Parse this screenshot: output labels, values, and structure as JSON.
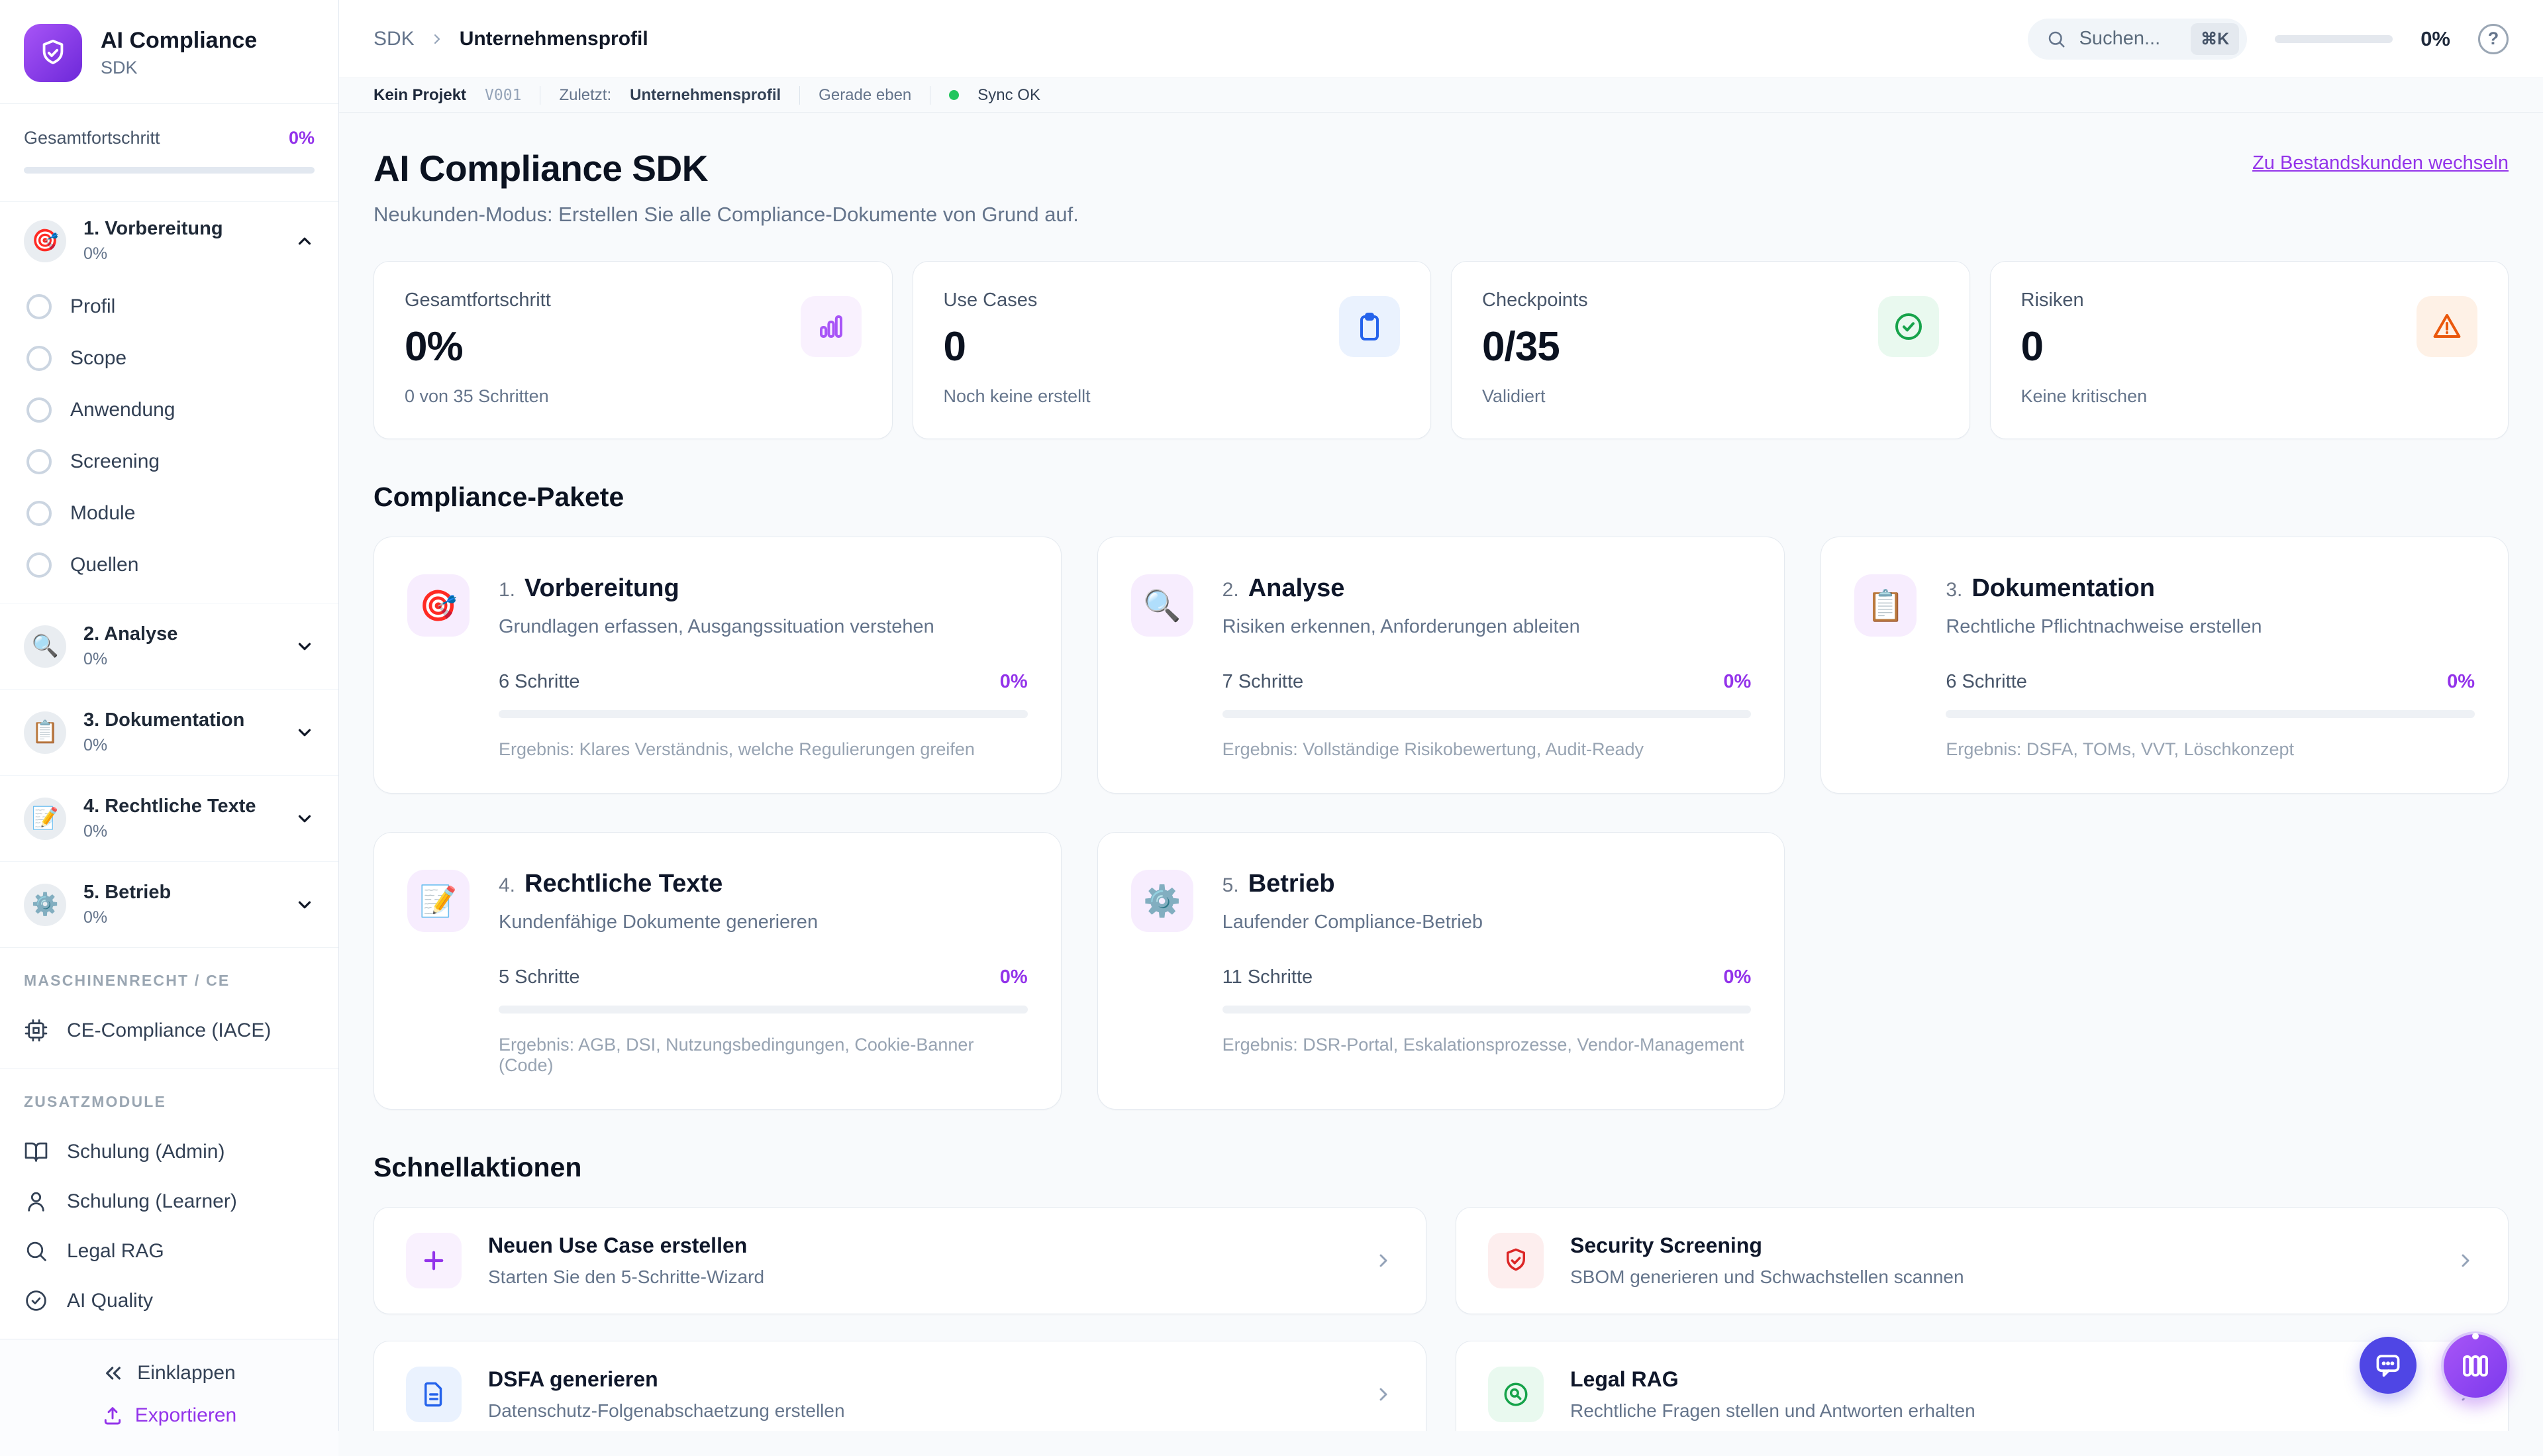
{
  "colors": {
    "accent_purple": "#9333ea",
    "logo_gradient": [
      "#a855f7",
      "#6d28d9"
    ],
    "sync_green": "#22c55e",
    "stat_purple": "#a855f7",
    "stat_blue": "#2563eb",
    "stat_green": "#16a34a",
    "stat_orange": "#ea580c",
    "action_red": "#dc2626",
    "fab_indigo": "#4f46e5"
  },
  "sidebar": {
    "logo": {
      "title": "AI Compliance",
      "subtitle": "SDK"
    },
    "progress": {
      "label": "Gesamtfortschritt",
      "value": "0%"
    },
    "phases": [
      {
        "emoji": "🎯",
        "label": "1. Vorbereitung",
        "percent": "0%",
        "subitems": [
          "Profil",
          "Scope",
          "Anwendung",
          "Screening",
          "Module",
          "Quellen"
        ]
      },
      {
        "emoji": "🔍",
        "label": "2. Analyse",
        "percent": "0%"
      },
      {
        "emoji": "📋",
        "label": "3. Dokumentation",
        "percent": "0%"
      },
      {
        "emoji": "📝",
        "label": "4. Rechtliche Texte",
        "percent": "0%"
      },
      {
        "emoji": "⚙️",
        "label": "5. Betrieb",
        "percent": "0%"
      }
    ],
    "sections": [
      {
        "heading": "MASCHINENRECHT / CE",
        "items": [
          {
            "icon": "cpu-icon",
            "label": "CE-Compliance (IACE)"
          }
        ]
      },
      {
        "heading": "ZUSATZMODULE",
        "items": [
          {
            "icon": "book-icon",
            "label": "Schulung (Admin)"
          },
          {
            "icon": "user-icon",
            "label": "Schulung (Learner)"
          },
          {
            "icon": "search-icon",
            "label": "Legal RAG"
          },
          {
            "icon": "check-circle-icon",
            "label": "AI Quality"
          }
        ]
      }
    ],
    "footer": {
      "collapse": "Einklappen",
      "export": "Exportieren"
    }
  },
  "topbar": {
    "breadcrumb": {
      "root": "SDK",
      "current": "Unternehmensprofil"
    },
    "search": {
      "placeholder": "Suchen...",
      "shortcut": "⌘K"
    },
    "progress": "0%"
  },
  "statusbar": {
    "project": "Kein Projekt",
    "version": "V001",
    "last_label": "Zuletzt:",
    "last_value": "Unternehmensprofil",
    "time": "Gerade eben",
    "sync": "Sync OK"
  },
  "hero": {
    "title": "AI Compliance SDK",
    "subtitle": "Neukunden-Modus: Erstellen Sie alle Compliance-Dokumente von Grund auf.",
    "switch_link": "Zu Bestandskunden wechseln"
  },
  "stats": [
    {
      "label": "Gesamtfortschritt",
      "value": "0%",
      "sub": "0 von 35 Schritten",
      "icon": "bar-chart-icon",
      "color": "#a855f7"
    },
    {
      "label": "Use Cases",
      "value": "0",
      "sub": "Noch keine erstellt",
      "icon": "clipboard-icon",
      "color": "#2563eb"
    },
    {
      "label": "Checkpoints",
      "value": "0/35",
      "sub": "Validiert",
      "icon": "check-circle-icon",
      "color": "#16a34a"
    },
    {
      "label": "Risiken",
      "value": "0",
      "sub": "Keine kritischen",
      "icon": "alert-triangle-icon",
      "color": "#ea580c"
    }
  ],
  "packages": {
    "heading": "Compliance-Pakete",
    "cards": [
      {
        "num": "1.",
        "emoji": "🎯",
        "title": "Vorbereitung",
        "desc": "Grundlagen erfassen, Ausgangssituation verstehen",
        "steps": "6 Schritte",
        "percent": "0%",
        "result": "Ergebnis: Klares Verständnis, welche Regulierungen greifen"
      },
      {
        "num": "2.",
        "emoji": "🔍",
        "title": "Analyse",
        "desc": "Risiken erkennen, Anforderungen ableiten",
        "steps": "7 Schritte",
        "percent": "0%",
        "result": "Ergebnis: Vollständige Risikobewertung, Audit-Ready"
      },
      {
        "num": "3.",
        "emoji": "📋",
        "title": "Dokumentation",
        "desc": "Rechtliche Pflichtnachweise erstellen",
        "steps": "6 Schritte",
        "percent": "0%",
        "result": "Ergebnis: DSFA, TOMs, VVT, Löschkonzept"
      },
      {
        "num": "4.",
        "emoji": "📝",
        "title": "Rechtliche Texte",
        "desc": "Kundenfähige Dokumente generieren",
        "steps": "5 Schritte",
        "percent": "0%",
        "result": "Ergebnis: AGB, DSI, Nutzungsbedingungen, Cookie-Banner (Code)"
      },
      {
        "num": "5.",
        "emoji": "⚙️",
        "title": "Betrieb",
        "desc": "Laufender Compliance-Betrieb",
        "steps": "11 Schritte",
        "percent": "0%",
        "result": "Ergebnis: DSR-Portal, Eskalationsprozesse, Vendor-Management"
      }
    ]
  },
  "quick_actions": {
    "heading": "Schnellaktionen",
    "items": [
      {
        "icon": "plus-icon",
        "title": "Neuen Use Case erstellen",
        "desc": "Starten Sie den 5-Schritte-Wizard",
        "color": "#9333ea"
      },
      {
        "icon": "shield-check-icon",
        "title": "Security Screening",
        "desc": "SBOM generieren und Schwachstellen scannen",
        "color": "#dc2626"
      },
      {
        "icon": "document-icon",
        "title": "DSFA generieren",
        "desc": "Datenschutz-Folgenabschaetzung erstellen",
        "color": "#2563eb"
      },
      {
        "icon": "search-badge-icon",
        "title": "Legal RAG",
        "desc": "Rechtliche Fragen stellen und Antworten erhalten",
        "color": "#16a34a"
      }
    ]
  }
}
